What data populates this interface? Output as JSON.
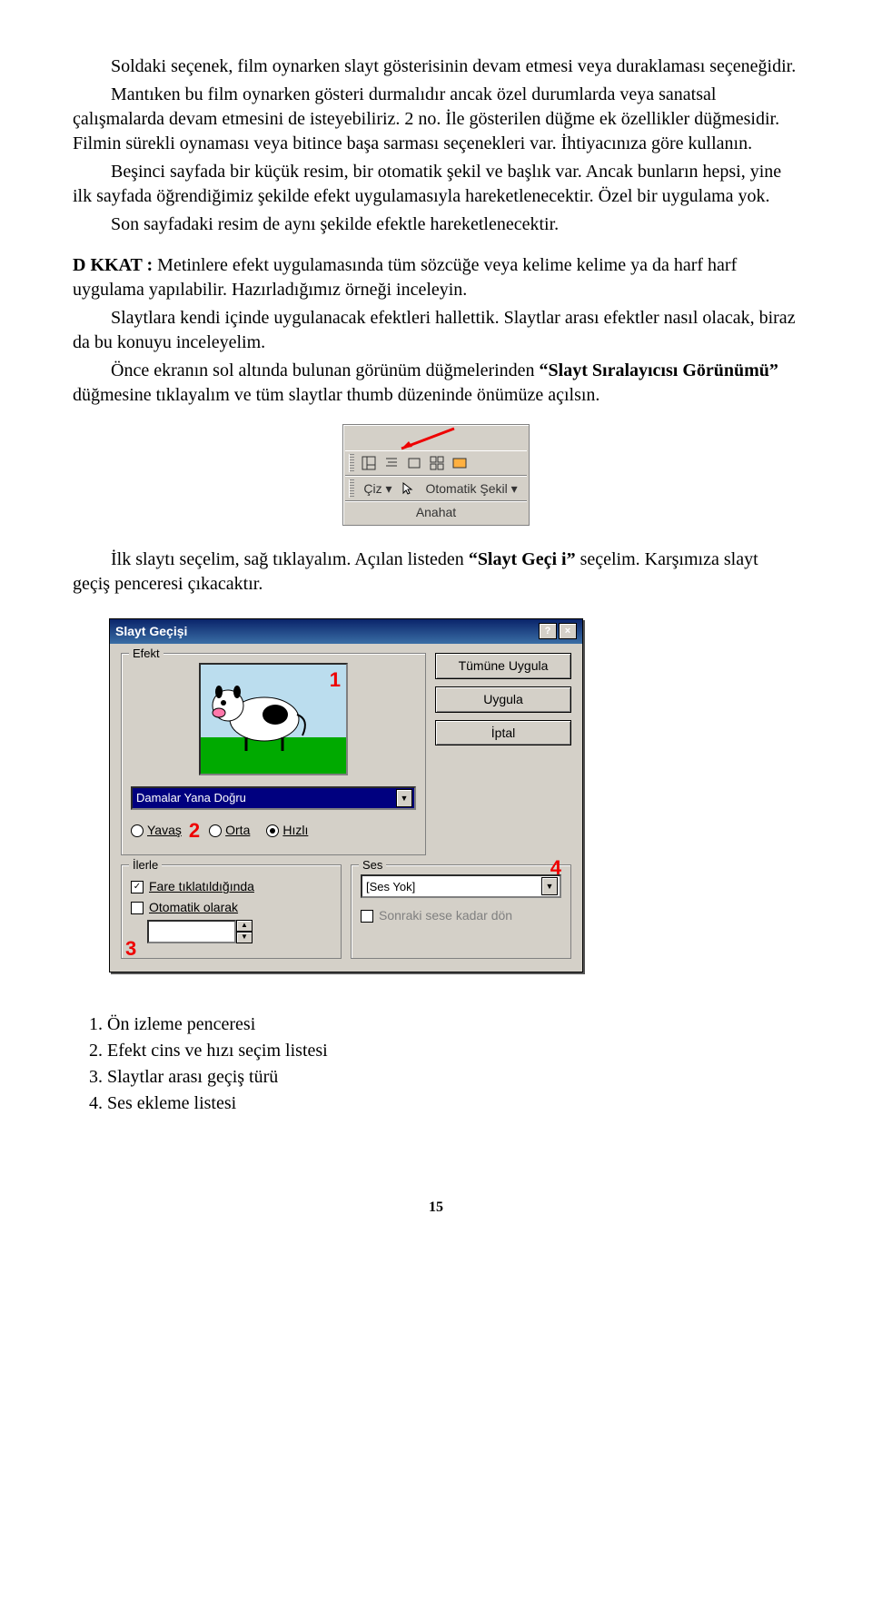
{
  "para1": "Soldaki seçenek, film oynarken slayt gösterisinin devam etmesi veya duraklaması seçeneğidir.",
  "para2": "Mantıken bu film oynarken gösteri durmalıdır ancak özel durumlarda veya sanatsal çalışmalarda devam etmesini de isteyebiliriz. 2 no. İle gösterilen düğme ek özellikler düğmesidir. Filmin sürekli oynaması veya bitince başa sarması seçenekleri var. İhtiyacınıza göre kullanın.",
  "para3": "Beşinci sayfada bir küçük resim, bir otomatik şekil ve başlık var. Ancak bunların hepsi, yine ilk sayfada öğrendiğimiz şekilde efekt uygulamasıyla hareketlenecektir. Özel bir uygulama yok.",
  "para4": "Son sayfadaki resim de aynı şekilde efektle hareketlenecektir.",
  "dikkat_label": "D KKAT :",
  "dikkat_rest": " Metinlere efekt uygulamasında tüm sözcüğe veya kelime kelime ya da harf harf uygulama yapılabilir.  Hazırladığımız örneği inceleyin.",
  "para6": "Slaytlara kendi içinde uygulanacak efektleri hallettik. Slaytlar arası efektler nasıl olacak, biraz da bu konuyu inceleyelim.",
  "para7a": "Önce ekranın sol altında bulunan görünüm düğmelerinden ",
  "para7b": "“Slayt Sıralayıcısı Görünümü”",
  "para7c": " düğmesine tıklayalım ve tüm slaytlar thumb düzeninde önümüze açılsın.",
  "toolbar": {
    "ciz": "Çiz ▾",
    "oto": "Otomatik Şekil ▾",
    "anahat": "Anahat"
  },
  "para8a": "İlk slaytı seçelim, sağ tıklayalım. Açılan listeden ",
  "para8b": "“Slayt Geçi i”",
  "para8c": " seçelim. Karşımıza slayt geçiş penceresi çıkacaktır.",
  "dialog": {
    "title": "Slayt Geçişi",
    "grp_efekt": "Efekt",
    "btn_tumune": "Tümüne Uygula",
    "btn_uygula": "Uygula",
    "btn_iptal": "İptal",
    "dd_effect": "Damalar Yana Doğru",
    "r_yavas": "Yavaş",
    "r_orta": "Orta",
    "r_hizli": "Hızlı",
    "grp_ilerle": "İlerle",
    "c_fare": "Fare tıklatıldığında",
    "c_oto": "Otomatik olarak",
    "grp_ses": "Ses",
    "dd_ses": "[Ses Yok]",
    "c_sonraki": "Sonraki sese kadar dön",
    "n1": "1",
    "n2": "2",
    "n3": "3",
    "n4": "4"
  },
  "legend": {
    "i1": "Ön izleme penceresi",
    "i2": "Efekt cins ve hızı seçim listesi",
    "i3": "Slaytlar arası geçiş türü",
    "i4": "Ses ekleme listesi"
  },
  "pagenum": "15"
}
